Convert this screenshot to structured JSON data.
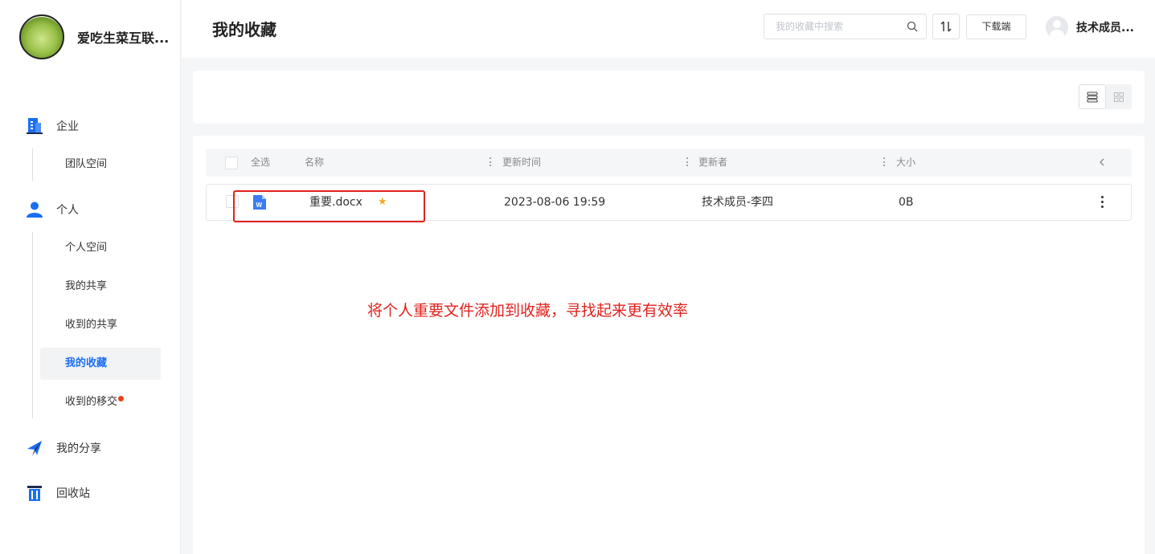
{
  "org": {
    "name": "爱吃生菜互联..."
  },
  "header": {
    "title": "我的收藏",
    "search_placeholder": "我的收藏中搜索",
    "download_label": "下载端",
    "user_name": "技术成员..."
  },
  "sidebar": {
    "groups": [
      {
        "label": "企业",
        "icon": "building-icon",
        "items": [
          {
            "label": "团队空间"
          }
        ]
      },
      {
        "label": "个人",
        "icon": "person-icon",
        "items": [
          {
            "label": "个人空间"
          },
          {
            "label": "我的共享"
          },
          {
            "label": "收到的共享"
          },
          {
            "label": "我的收藏",
            "active": true
          },
          {
            "label": "收到的移交",
            "badge": true
          }
        ]
      },
      {
        "label": "我的分享",
        "icon": "paper-plane-icon"
      },
      {
        "label": "回收站",
        "icon": "trash-icon"
      }
    ]
  },
  "table": {
    "select_all": "全选",
    "columns": [
      "名称",
      "更新时间",
      "更新者",
      "大小"
    ],
    "rows": [
      {
        "name": "重要.docx",
        "starred": true,
        "updated": "2023-08-06 19:59",
        "updater": "技术成员-李四",
        "size": "0B"
      }
    ]
  },
  "annotation": "将个人重要文件添加到收藏，寻找起来更有效率",
  "colors": {
    "accent": "#1a6ef5",
    "star": "#f5a623",
    "annotation": "#e0231e",
    "badge": "#e8401c"
  }
}
